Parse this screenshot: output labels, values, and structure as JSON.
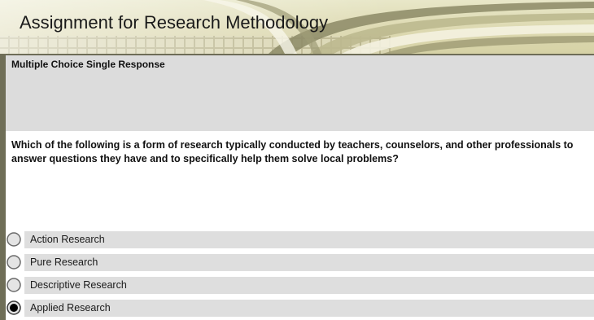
{
  "header": {
    "title": "Assignment for Research Methodology"
  },
  "question": {
    "type_label": "Multiple Choice Single Response",
    "text": "Which of the following is a form of research typically conducted by teachers, counselors, and other professionals to answer questions they have and to specifically help them solve local problems?"
  },
  "options": [
    {
      "label": "Action Research",
      "selected": false
    },
    {
      "label": "Pure Research",
      "selected": false
    },
    {
      "label": "Descriptive Research",
      "selected": false
    },
    {
      "label": "Applied Research",
      "selected": true
    }
  ],
  "colors": {
    "header_bg": "#ddd9b1",
    "border": "#6f6e57",
    "band": "#dcdcdc",
    "option_bar": "#dedede"
  }
}
